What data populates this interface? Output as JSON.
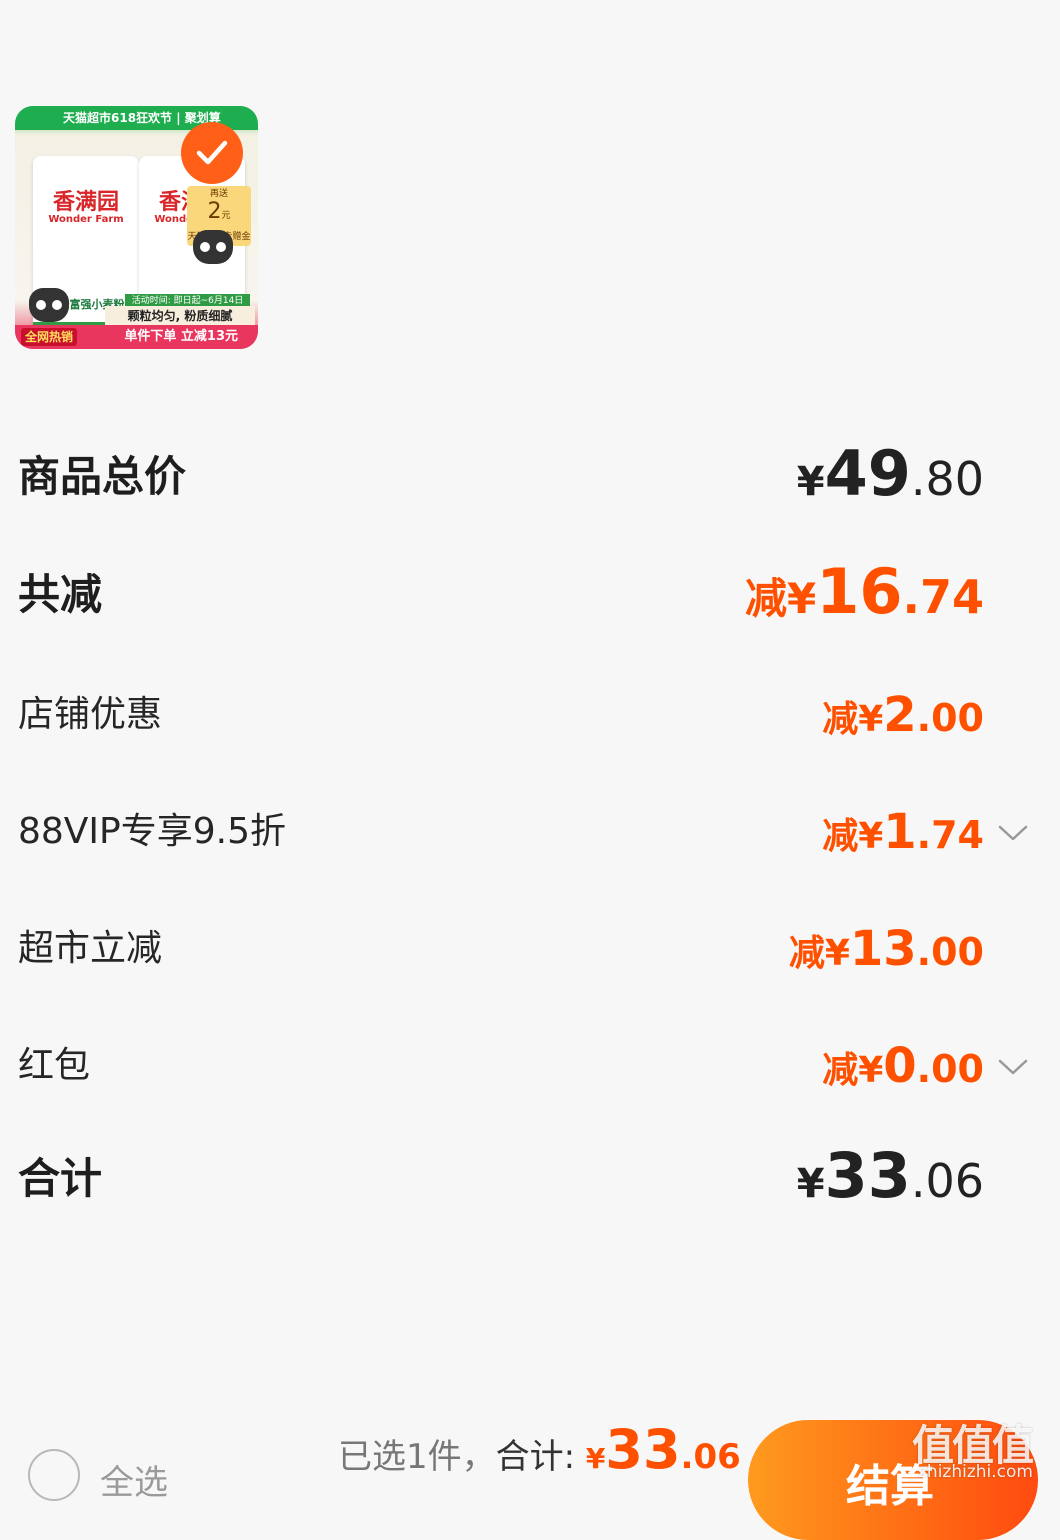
{
  "product": {
    "banner": "天猫超市618狂欢节 | 聚划算",
    "brand_cn": "香满园",
    "brand_en": "Wonder Farm",
    "desc": "美味富强小麦粉",
    "voucher_prefix": "再送",
    "voucher_amount": "2",
    "voucher_unit": "元",
    "voucher_text": "天猫超市卡赠金",
    "date_text": "活动时间: 即日起~6月14日",
    "promo_line1": "颗粒均匀, 粉质细腻",
    "promo_line2": "单件下单 立减13元",
    "hot_tag": "全网热销",
    "selected": true,
    "accent": "#ff5f16"
  },
  "rows": {
    "total": {
      "label": "商品总价",
      "currency": "¥",
      "int": "49",
      "dec": ".80"
    },
    "discount": {
      "label": "共减",
      "prefix": "减¥",
      "int": "16",
      "dec": ".74"
    },
    "store": {
      "label": "店铺优惠",
      "prefix": "减¥",
      "int": "2",
      "dec": ".00"
    },
    "vip": {
      "label": "88VIP专享9.5折",
      "prefix": "减¥",
      "int": "1",
      "dec": ".74",
      "icon": "chevron-down-icon"
    },
    "market": {
      "label": "超市立减",
      "prefix": "减¥",
      "int": "13",
      "dec": ".00"
    },
    "redpacket": {
      "label": "红包",
      "prefix": "减¥",
      "int": "0",
      "dec": ".00",
      "icon": "chevron-down-icon"
    },
    "sum": {
      "label": "合计",
      "currency": "¥",
      "int": "33",
      "dec": ".06"
    }
  },
  "bottom": {
    "select_all": "全选",
    "selected_count": "已选1件，",
    "sum_label": "合计: ",
    "sum_currency": "¥",
    "sum_int": "33",
    "sum_dec": ".06",
    "checkout": "结算",
    "watermark": "值值值",
    "watermark_url": "zhizhizhi.com"
  },
  "colors": {
    "accent": "#ff5000",
    "checkout_start": "#ff9a1e",
    "checkout_end": "#ff4a10",
    "background": "#f7f7f7"
  }
}
